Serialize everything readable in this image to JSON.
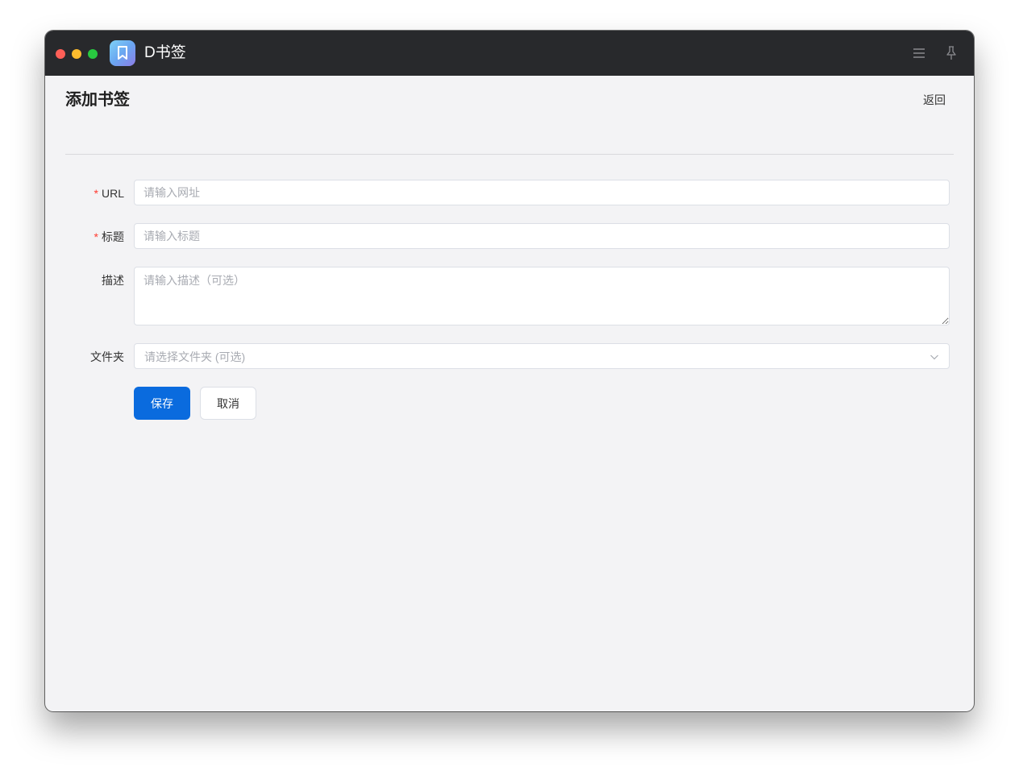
{
  "window": {
    "app_title": "D书签",
    "colors": {
      "titlebar": "#28292c",
      "accent": "#0a6bde",
      "required": "#ff3b30"
    },
    "icons": [
      "bookmark-icon",
      "menu-icon",
      "pin-icon"
    ]
  },
  "header": {
    "title": "添加书签",
    "back_label": "返回"
  },
  "form": {
    "url": {
      "required_mark": "*",
      "label": "URL",
      "placeholder": "请输入网址"
    },
    "title": {
      "required_mark": "*",
      "label": "标题",
      "placeholder": "请输入标题"
    },
    "description": {
      "label": "描述",
      "placeholder": "请输入描述（可选）"
    },
    "folder": {
      "label": "文件夹",
      "placeholder": "请选择文件夹 (可选)"
    }
  },
  "actions": {
    "save_label": "保存",
    "cancel_label": "取消"
  }
}
